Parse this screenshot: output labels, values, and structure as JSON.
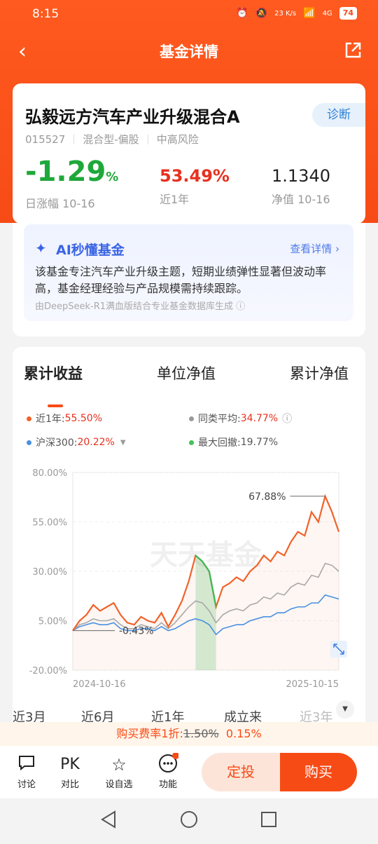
{
  "status": {
    "time": "8:15",
    "net_speed": "23 K/s",
    "signal": "4G",
    "battery": "74"
  },
  "nav": {
    "title": "基金详情"
  },
  "fund": {
    "name": "弘毅远方汽车产业升级混合A",
    "diagnose": "诊断",
    "code": "015527",
    "type": "混合型-偏股",
    "risk": "中高风险",
    "day_change_num": "-1.29",
    "day_change_pct": "%",
    "day_change_label": "日涨幅 10-16",
    "year_return": "53.49%",
    "year_label": "近1年",
    "nav_value": "1.1340",
    "nav_label": "净值 10-16"
  },
  "ai": {
    "title": "AI秒懂基金",
    "more": "查看详情",
    "text": "该基金专注汽车产业升级主题，短期业绩弹性显著但波动率高，基金经理经验与产品规模需持续跟踪。",
    "source": "由DeepSeek-R1满血版结合专业基金数据库生成"
  },
  "chart_tabs": [
    "累计收益",
    "单位净值",
    "累计净值"
  ],
  "legend": {
    "fund_label": "近1年:",
    "fund_value": "55.50%",
    "avg_label": "同类平均:",
    "avg_value": "34.77%",
    "hs_label": "沪深300:",
    "hs_value": "20.22%",
    "dd_label": "最大回撤:",
    "dd_value": "19.77%"
  },
  "chart_data": {
    "type": "line",
    "ylim": [
      -20,
      80
    ],
    "yticks": [
      "80.00%",
      "55.00%",
      "30.00%",
      "5.00%",
      "-20.00%"
    ],
    "x_start": "2024-10-16",
    "x_end": "2025-10-15",
    "annotations": {
      "max": "67.88%",
      "min": "-0.43%"
    },
    "watermark": "天天基金",
    "series": [
      {
        "name": "近1年",
        "color": "#f0622a",
        "values": [
          0,
          5,
          8,
          13,
          10,
          12,
          14,
          8,
          4,
          3,
          7,
          5,
          4,
          9,
          2,
          8,
          15,
          25,
          38,
          35,
          30,
          12,
          22,
          24,
          27,
          25,
          30,
          33,
          38,
          35,
          40,
          38,
          45,
          50,
          48,
          60,
          55,
          68,
          60,
          50
        ]
      },
      {
        "name": "同类平均",
        "color": "#a9a9a9",
        "values": [
          0,
          3,
          4,
          6,
          5,
          5,
          6,
          3,
          1,
          1,
          3,
          2,
          1,
          4,
          1,
          4,
          8,
          12,
          15,
          14,
          10,
          4,
          8,
          10,
          11,
          10,
          13,
          14,
          17,
          16,
          19,
          18,
          22,
          24,
          23,
          28,
          27,
          34,
          33,
          30
        ]
      },
      {
        "name": "沪深300",
        "color": "#4a90e2",
        "values": [
          0,
          2,
          3,
          4,
          3,
          3,
          4,
          1,
          0,
          0,
          1,
          1,
          0,
          2,
          0,
          1,
          3,
          5,
          6,
          5,
          3,
          -2,
          1,
          2,
          3,
          3,
          5,
          6,
          7,
          7,
          9,
          9,
          11,
          12,
          12,
          14,
          14,
          18,
          17,
          16
        ]
      }
    ]
  },
  "periods": [
    "近3月",
    "近6月",
    "近1年",
    "成立来",
    "近3年"
  ],
  "fee": {
    "prefix": "购买费率1折:",
    "original": "1.50%",
    "current": "0.15%"
  },
  "bottom": {
    "discuss": "讨论",
    "pk": "PK",
    "compare": "对比",
    "watch": "设自选",
    "func": "功能",
    "fixed": "定投",
    "buy": "购买"
  }
}
